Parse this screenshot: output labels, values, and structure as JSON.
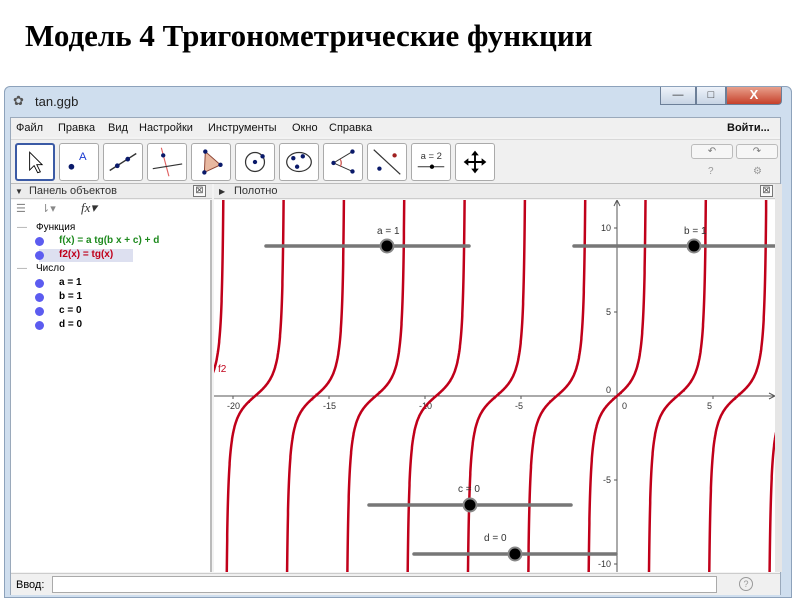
{
  "slide_title": "Модель 4  Тригонометрические функции",
  "window": {
    "title": "tan.ggb",
    "minimize": "—",
    "maximize": "□",
    "close": "X"
  },
  "menu": [
    "Файл",
    "Правка",
    "Вид",
    "Настройки",
    "Инструменты",
    "Окно",
    "Справка"
  ],
  "login": "Войти...",
  "tools": [
    "move",
    "point",
    "line",
    "perpendicular",
    "polygon",
    "circle",
    "conic",
    "angle",
    "reflect",
    "slider",
    "move-view"
  ],
  "slider_tool_label": "a = 2",
  "undo": "↶",
  "redo": "↷",
  "help_icon": "?",
  "settings_icon": "⚙",
  "algebra_panel": {
    "title": "Панель объектов",
    "close": "⊠",
    "fx": "fx",
    "groups": [
      {
        "name": "Функция",
        "items": [
          {
            "text": "f(x) = a tg(b x + c) + d",
            "color": "#1e8a1e"
          },
          {
            "text": "f2(x) = tg(x)",
            "color": "#c0001a",
            "selected": true
          }
        ]
      },
      {
        "name": "Число",
        "items": [
          {
            "text": "a = 1"
          },
          {
            "text": "b = 1"
          },
          {
            "text": "c = 0"
          },
          {
            "text": "d = 0"
          }
        ]
      }
    ]
  },
  "graphics_panel": {
    "title": "Полотно",
    "close": "⊠",
    "curve_label": "f2",
    "sliders": [
      {
        "label": "a = 1",
        "value": 1
      },
      {
        "label": "b = 1",
        "value": 1
      },
      {
        "label": "c = 0",
        "value": 0
      },
      {
        "label": "d = 0",
        "value": 0
      }
    ],
    "x_ticks": [
      "-20",
      "-15",
      "-10",
      "-5",
      "0",
      "5"
    ],
    "y_ticks": [
      "10",
      "5",
      "0",
      "-5",
      "-10"
    ],
    "function": "tan(x)",
    "curve_color": "#c0001a",
    "x_range": [
      -21,
      8
    ],
    "y_range": [
      -10.5,
      11.5
    ]
  },
  "input_bar": {
    "label": "Ввод:",
    "value": "",
    "help": "?"
  }
}
